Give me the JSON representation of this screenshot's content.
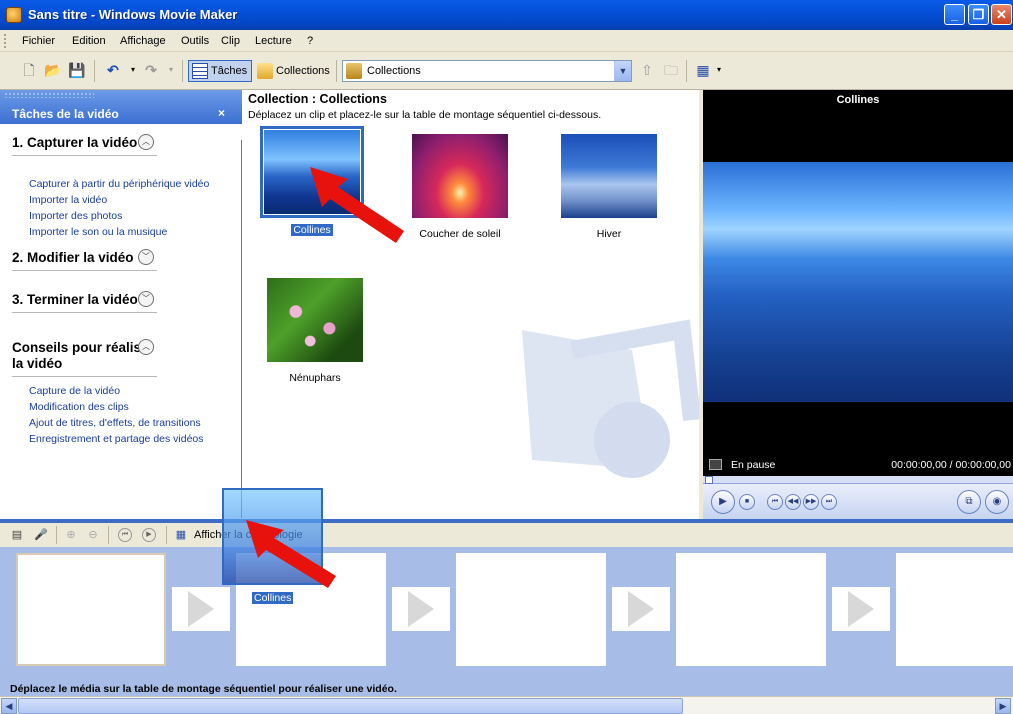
{
  "window": {
    "title": "Sans titre - Windows Movie Maker"
  },
  "menu": [
    "Fichier",
    "Edition",
    "Affichage",
    "Outils",
    "Clip",
    "Lecture",
    "?"
  ],
  "toolbar": {
    "taches_label": "Tâches",
    "collections_label": "Collections",
    "collection_select_value": "Collections"
  },
  "taskpane": {
    "title": "Tâches de la vidéo",
    "close": "×",
    "sections": [
      {
        "title": "1. Capturer la vidéo",
        "links": [
          "Capturer à partir du périphérique vidéo",
          "Importer la vidéo",
          "Importer des photos",
          "Importer le son ou la musique"
        ]
      },
      {
        "title": "2. Modifier la vidéo",
        "links": []
      },
      {
        "title": "3. Terminer la vidéo",
        "links": []
      },
      {
        "title": "Conseils pour réaliser la vidéo",
        "links": [
          "Capture de la vidéo",
          "Modification des clips",
          "Ajout de titres, d'effets, de transitions",
          "Enregistrement et partage des vidéos"
        ]
      }
    ]
  },
  "collection": {
    "title": "Collection : Collections",
    "description": "Déplacez un clip et placez-le sur la table de montage séquentiel ci-dessous.",
    "clips": [
      {
        "name": "Collines",
        "selected": true
      },
      {
        "name": "Coucher de soleil",
        "selected": false
      },
      {
        "name": "Hiver",
        "selected": false
      },
      {
        "name": "Nénuphars",
        "selected": false
      }
    ]
  },
  "monitor": {
    "title": "Collines",
    "status": "En pause",
    "time": "00:00:00,00 / 00:00:00,00"
  },
  "storyboard": {
    "toolbar_label": "Afficher la chronologie",
    "drag_label": "Collines",
    "hint": "Déplacez le média sur la table de montage séquentiel pour réaliser une vidéo."
  }
}
